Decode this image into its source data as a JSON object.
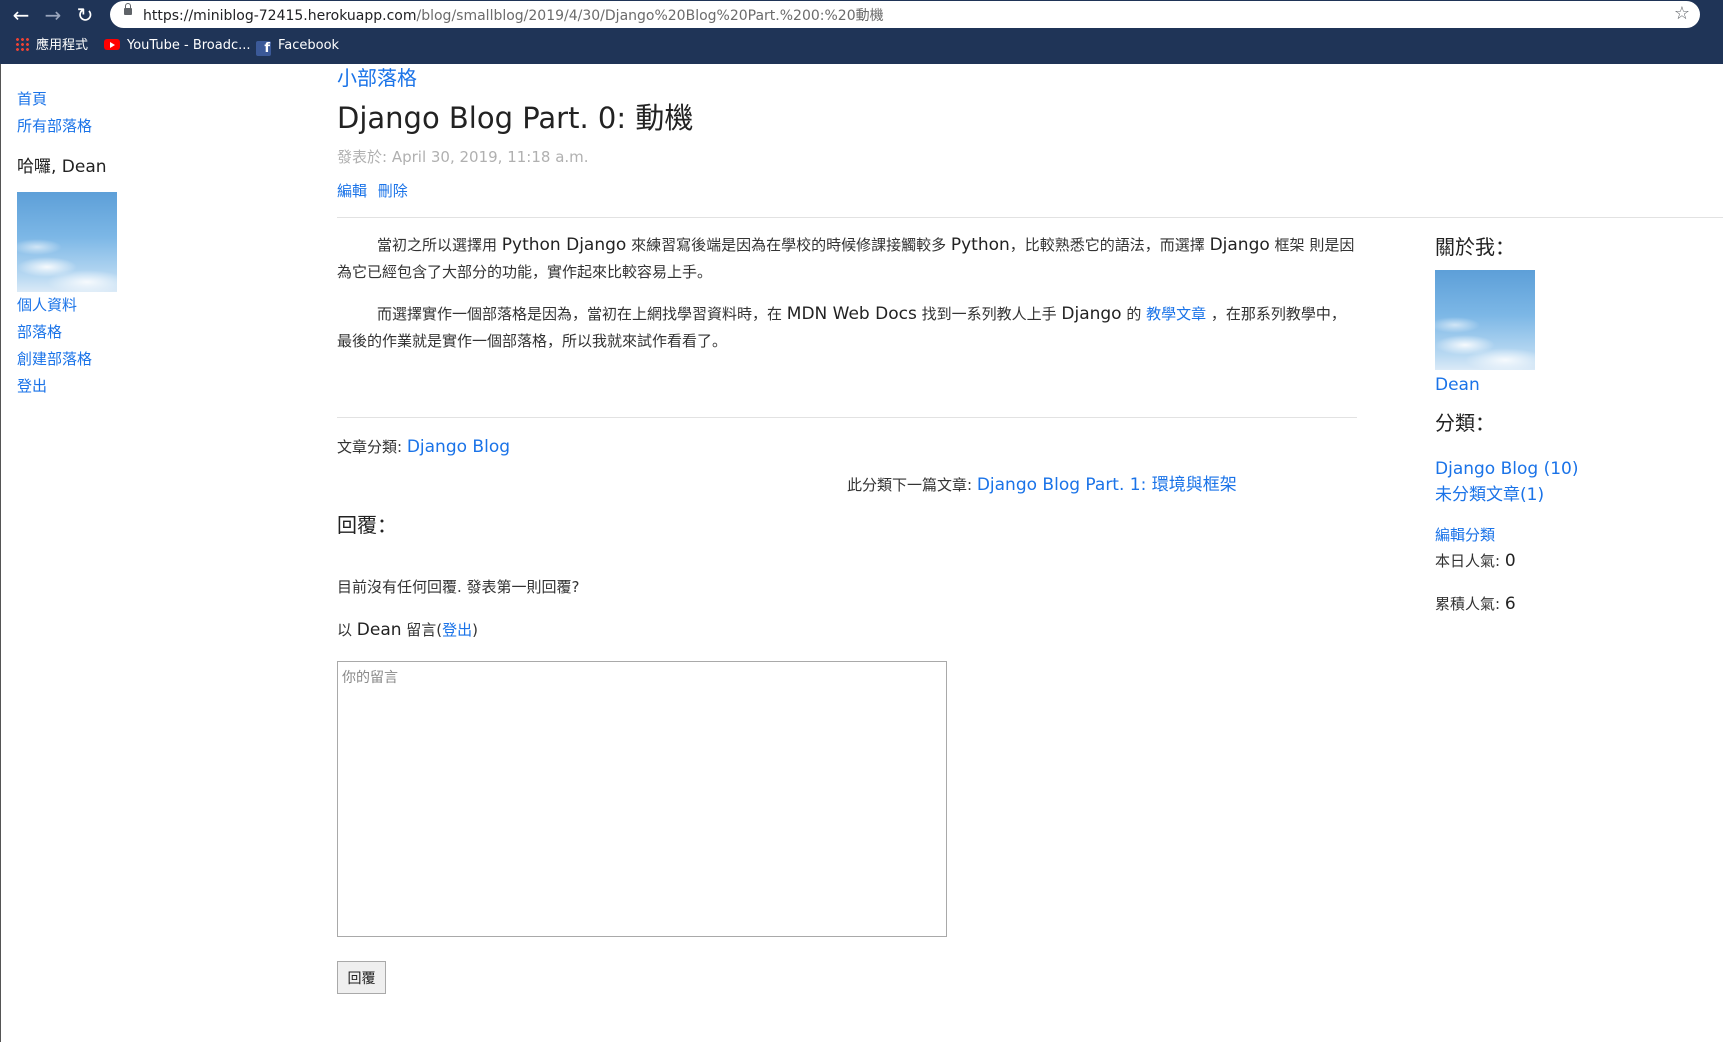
{
  "browser": {
    "url_host": "https://miniblog-72415.herokuapp.com",
    "url_path": "/blog/smallblog/2019/4/30/Django%20Blog%20Part.%200:%20動機",
    "bookmarks": [
      {
        "label": "應用程式"
      },
      {
        "label": "YouTube - Broadc..."
      },
      {
        "label": "Facebook"
      }
    ]
  },
  "sidebar": {
    "home": "首頁",
    "all_blogs": "所有部落格",
    "greeting": "哈囉, Dean",
    "profile": "個人資料",
    "blog": "部落格",
    "create_blog": "創建部落格",
    "logout": "登出"
  },
  "post": {
    "blog_name": "小部落格",
    "title": "Django Blog Part. 0: 動機",
    "date": "發表於: April 30, 2019, 11:18 a.m.",
    "edit": "編輯",
    "delete": "刪除",
    "para1_a": "當初之所以選擇用 ",
    "para1_b": "Python Django",
    "para1_c": " 來練習寫後端是因為在學校的時候修課接觸較多 ",
    "para1_d": "Python",
    "para1_e": "，比較熟悉它的語法，而選擇 ",
    "para1_f": "Django",
    "para1_g": " 框架 則是因為它已經包含了大部分的功能，實作起來比較容易上手。",
    "para2_a": "而選擇實作一個部落格是因為，當初在上網找學習資料時，在 ",
    "para2_b": "MDN Web Docs",
    "para2_c": " 找到一系列教人上手 ",
    "para2_d": "Django",
    "para2_e": " 的 ",
    "para2_link": "教學文章",
    "para2_f": " ，在那系列教學中，最後的作業就是實作一個部落格，所以我就來試作看看了。",
    "category_label": "文章分類: ",
    "category": "Django Blog",
    "next_label": "此分類下一篇文章: ",
    "next_post": "Django Blog Part. 1: 環境與框架"
  },
  "replies": {
    "heading": "回覆：",
    "empty": "目前沒有任何回覆. 發表第一則回覆?",
    "as_prefix": "以 ",
    "as_user": "Dean",
    "as_suffix": " 留言(",
    "as_logout": "登出",
    "as_close": ")",
    "placeholder": "你的留言",
    "submit": "回覆"
  },
  "about": {
    "heading": "關於我：",
    "name": "Dean",
    "categories_heading": "分類：",
    "categories": [
      {
        "label": "Django Blog (10)"
      },
      {
        "label": "未分類文章(1)"
      }
    ],
    "edit_categories": "編輯分類",
    "today_label": "本日人氣: ",
    "today_value": "0",
    "total_label": "累積人氣: ",
    "total_value": "6"
  }
}
